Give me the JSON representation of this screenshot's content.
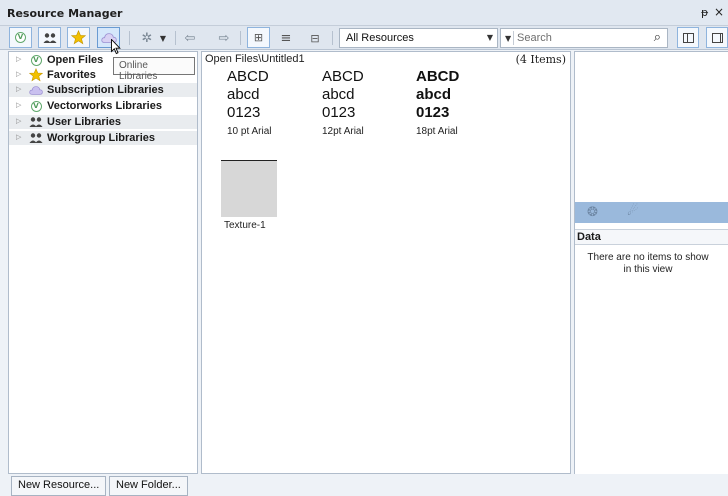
{
  "window": {
    "title": "Resource Manager",
    "pin_glyph": "ᵽ",
    "close_glyph": "×"
  },
  "toolbar": {
    "scope_dropdown_value": "All Resources",
    "search_placeholder": "Search",
    "icons": [
      "vectorworks-icon",
      "users-icon",
      "star-icon",
      "cloud-icon",
      "gear-icon",
      "back-arrow-icon",
      "forward-arrow-icon",
      "thumbnail-view-icon",
      "list-view-icon",
      "detail-view-icon",
      "search-icon"
    ]
  },
  "tooltip": {
    "text": "Online Libraries"
  },
  "tree": {
    "items": [
      {
        "label": "Open Files",
        "icon": "vectorworks-icon"
      },
      {
        "label": "Favorites",
        "icon": "star-icon"
      },
      {
        "label": "Subscription Libraries",
        "icon": "cloud-icon"
      },
      {
        "label": "Vectorworks Libraries",
        "icon": "vectorworks-icon"
      },
      {
        "label": "User Libraries",
        "icon": "users-icon"
      },
      {
        "label": "Workgroup Libraries",
        "icon": "users-icon"
      }
    ]
  },
  "browser": {
    "path": "Open Files\\Untitled1",
    "count": "(4 Items)",
    "samples": [
      {
        "line1": "ABCD",
        "line2": "abcd",
        "line3": "0123",
        "caption": "10 pt Arial"
      },
      {
        "line1": "ABCD",
        "line2": "abcd",
        "line3": "0123",
        "caption": "12pt Arial"
      },
      {
        "line1": "ABCD",
        "line2": "abcd",
        "line3": "0123",
        "caption": "18pt Arial"
      }
    ],
    "texture_label": "Texture-1"
  },
  "preview": {
    "data_heading": "Data",
    "empty_message": "There are no items to show in this view"
  },
  "footer": {
    "new_resource_label": "New Resource...",
    "new_folder_label": "New Folder..."
  },
  "colors": {
    "accent": "#9ab9dc",
    "toolbar": "#dfe6ef",
    "star": "#f2c000",
    "cloud": "#b9aee6"
  }
}
